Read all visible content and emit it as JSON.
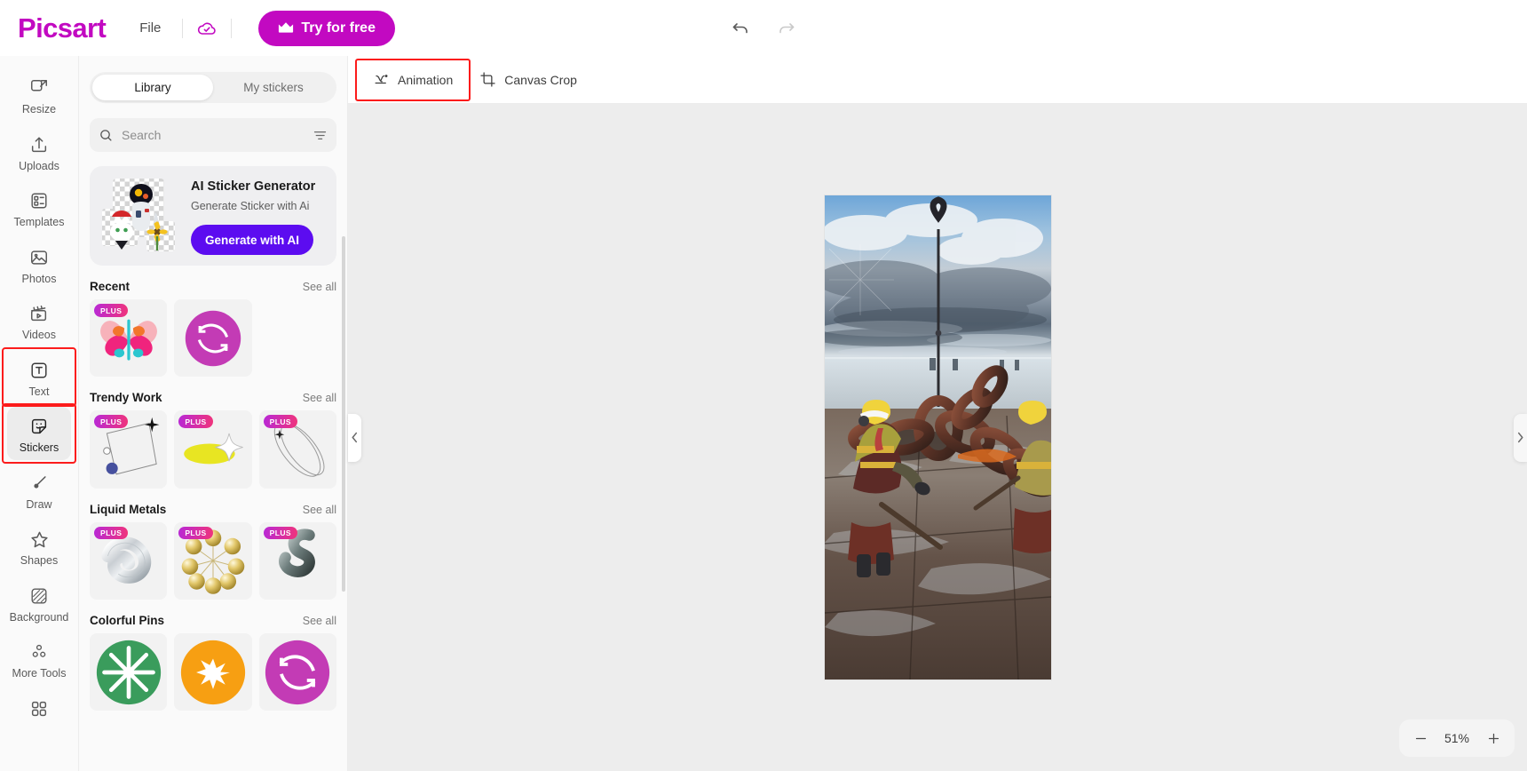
{
  "app": {
    "brand": "Picsart",
    "brand_color": "#c209c1",
    "accent_highlight_color": "#fc1b1b",
    "ai_button_color": "#5c0cf0"
  },
  "topbar": {
    "file_label": "File",
    "cloud_icon": "cloud-check-icon",
    "try_label": "Try for free",
    "try_icon": "crown-icon",
    "undo_icon": "undo-arrow-icon",
    "redo_icon": "redo-arrow-icon"
  },
  "rail": {
    "items": [
      {
        "label": "Resize",
        "icon": "resize-icon",
        "active": false,
        "highlighted": false
      },
      {
        "label": "Uploads",
        "icon": "upload-icon",
        "active": false,
        "highlighted": false
      },
      {
        "label": "Templates",
        "icon": "templates-icon",
        "active": false,
        "highlighted": false
      },
      {
        "label": "Photos",
        "icon": "photo-icon",
        "active": false,
        "highlighted": false
      },
      {
        "label": "Videos",
        "icon": "video-clapper-icon",
        "active": false,
        "highlighted": false
      },
      {
        "label": "Text",
        "icon": "text-t-icon",
        "active": false,
        "highlighted": true
      },
      {
        "label": "Stickers",
        "icon": "sticker-icon",
        "active": true,
        "highlighted": true
      },
      {
        "label": "Draw",
        "icon": "brush-icon",
        "active": false,
        "highlighted": false
      },
      {
        "label": "Shapes",
        "icon": "star-outline-icon",
        "active": false,
        "highlighted": false
      },
      {
        "label": "Background",
        "icon": "background-hatch-icon",
        "active": false,
        "highlighted": false
      },
      {
        "label": "More Tools",
        "icon": "more-tools-dots-icon",
        "active": false,
        "highlighted": false
      },
      {
        "label": "",
        "icon": "apps-grid-icon",
        "active": false,
        "highlighted": false
      }
    ]
  },
  "panel": {
    "tabs": [
      {
        "label": "Library",
        "active": true
      },
      {
        "label": "My stickers",
        "active": false
      }
    ],
    "search": {
      "placeholder": "Search",
      "value": "",
      "icon": "search-icon",
      "filter_icon": "filter-sliders-icon"
    },
    "ai_card": {
      "title": "AI Sticker Generator",
      "subtitle": "Generate Sticker with Ai",
      "button_label": "Generate with AI",
      "thumb_name": "ai-sticker-preview-thumbnail"
    },
    "see_all_label": "See all",
    "plus_badge_label": "PLUS",
    "sections": [
      {
        "title": "Recent",
        "tiles": [
          {
            "name": "butterfly-sticker",
            "plus": true,
            "kind": "butterfly"
          },
          {
            "name": "magenta-arrow-circle-sticker",
            "plus": false,
            "kind": "circle-arrow-magenta"
          }
        ]
      },
      {
        "title": "Trendy Work",
        "tiles": [
          {
            "name": "tilted-square-sparkle-sticker",
            "plus": true,
            "kind": "square-sparkle"
          },
          {
            "name": "yellow-ellipse-sparkle-sticker",
            "plus": true,
            "kind": "yellow-ellipse"
          },
          {
            "name": "thin-oval-outline-sticker",
            "plus": true,
            "kind": "oval-outline"
          }
        ]
      },
      {
        "title": "Liquid Metals",
        "tiles": [
          {
            "name": "chrome-twist-sticker",
            "plus": true,
            "kind": "chrome-twist"
          },
          {
            "name": "gold-spheres-flower-sticker",
            "plus": true,
            "kind": "gold-flower"
          },
          {
            "name": "dark-metal-squiggle-sticker",
            "plus": true,
            "kind": "metal-squiggle"
          }
        ]
      },
      {
        "title": "Colorful Pins",
        "tiles": [
          {
            "name": "green-asterisk-pin",
            "plus": false,
            "kind": "green-asterisk"
          },
          {
            "name": "orange-star-pin",
            "plus": false,
            "kind": "orange-star"
          },
          {
            "name": "magenta-arrow-circle-pin",
            "plus": false,
            "kind": "circle-arrow-magenta"
          }
        ]
      }
    ]
  },
  "canvas_toolbar": {
    "tools": [
      {
        "label": "Animation",
        "icon": "animation-curve-icon",
        "highlighted": true
      },
      {
        "label": "Canvas Crop",
        "icon": "crop-icon",
        "highlighted": false
      }
    ]
  },
  "stage": {
    "artboard_name": "video-canvas-workers-chain",
    "left_handle_icon": "chevron-left-icon",
    "right_handle_icon": "chevron-right-icon"
  },
  "zoom_control": {
    "minus_icon": "minus-icon",
    "plus_icon": "plus-icon",
    "value": "51%"
  }
}
